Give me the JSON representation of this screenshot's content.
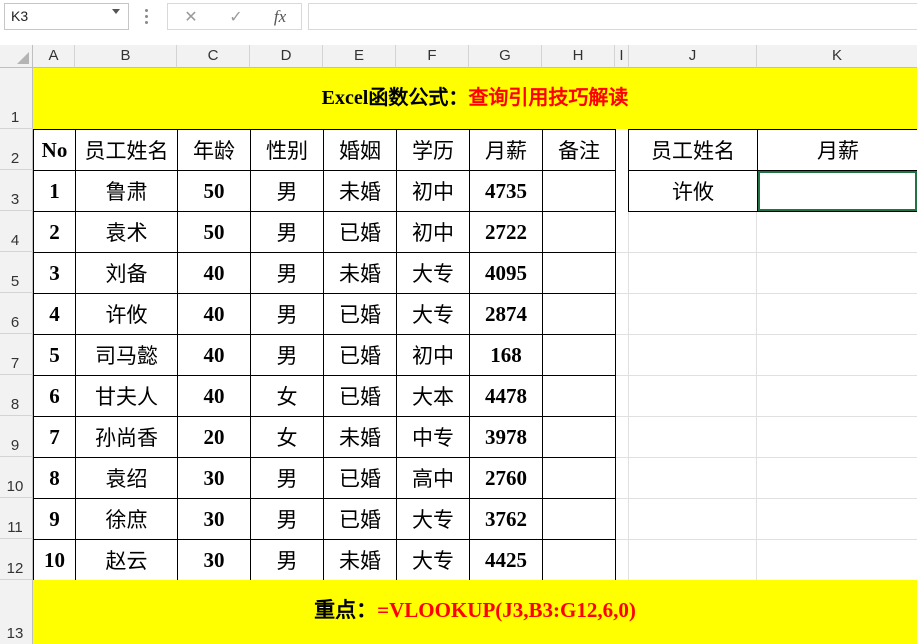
{
  "name_box": {
    "value": "K3"
  },
  "formula_bar": {
    "cancel_glyph": "✕",
    "enter_glyph": "✓",
    "fx_label": "fx",
    "content": ""
  },
  "columns": [
    "A",
    "B",
    "C",
    "D",
    "E",
    "F",
    "G",
    "H",
    "I",
    "J",
    "K"
  ],
  "rows": [
    "1",
    "2",
    "3",
    "4",
    "5",
    "6",
    "7",
    "8",
    "9",
    "10",
    "11",
    "12",
    "13"
  ],
  "title": {
    "part1": "Excel函数公式：",
    "part2": "查询引用技巧解读"
  },
  "table": {
    "headers": [
      "No",
      "员工姓名",
      "年龄",
      "性别",
      "婚姻",
      "学历",
      "月薪",
      "备注"
    ],
    "rows": [
      [
        "1",
        "鲁肃",
        "50",
        "男",
        "未婚",
        "初中",
        "4735",
        ""
      ],
      [
        "2",
        "袁术",
        "50",
        "男",
        "已婚",
        "初中",
        "2722",
        ""
      ],
      [
        "3",
        "刘备",
        "40",
        "男",
        "未婚",
        "大专",
        "4095",
        ""
      ],
      [
        "4",
        "许攸",
        "40",
        "男",
        "已婚",
        "大专",
        "2874",
        ""
      ],
      [
        "5",
        "司马懿",
        "40",
        "男",
        "已婚",
        "初中",
        "168",
        ""
      ],
      [
        "6",
        "甘夫人",
        "40",
        "女",
        "已婚",
        "大本",
        "4478",
        ""
      ],
      [
        "7",
        "孙尚香",
        "20",
        "女",
        "未婚",
        "中专",
        "3978",
        ""
      ],
      [
        "8",
        "袁绍",
        "30",
        "男",
        "已婚",
        "高中",
        "2760",
        ""
      ],
      [
        "9",
        "徐庶",
        "30",
        "男",
        "已婚",
        "大专",
        "3762",
        ""
      ],
      [
        "10",
        "赵云",
        "30",
        "男",
        "未婚",
        "大专",
        "4425",
        ""
      ]
    ]
  },
  "lookup": {
    "header_name": "员工姓名",
    "header_salary": "月薪",
    "name": "许攸",
    "salary": ""
  },
  "footer": {
    "part1": "重点：",
    "part2": "=VLOOKUP(J3,B3:G12,6,0)"
  },
  "colors": {
    "banner_bg": "#ffff00",
    "accent_red": "#ff0000",
    "header_bg": "#f2f2f2"
  }
}
